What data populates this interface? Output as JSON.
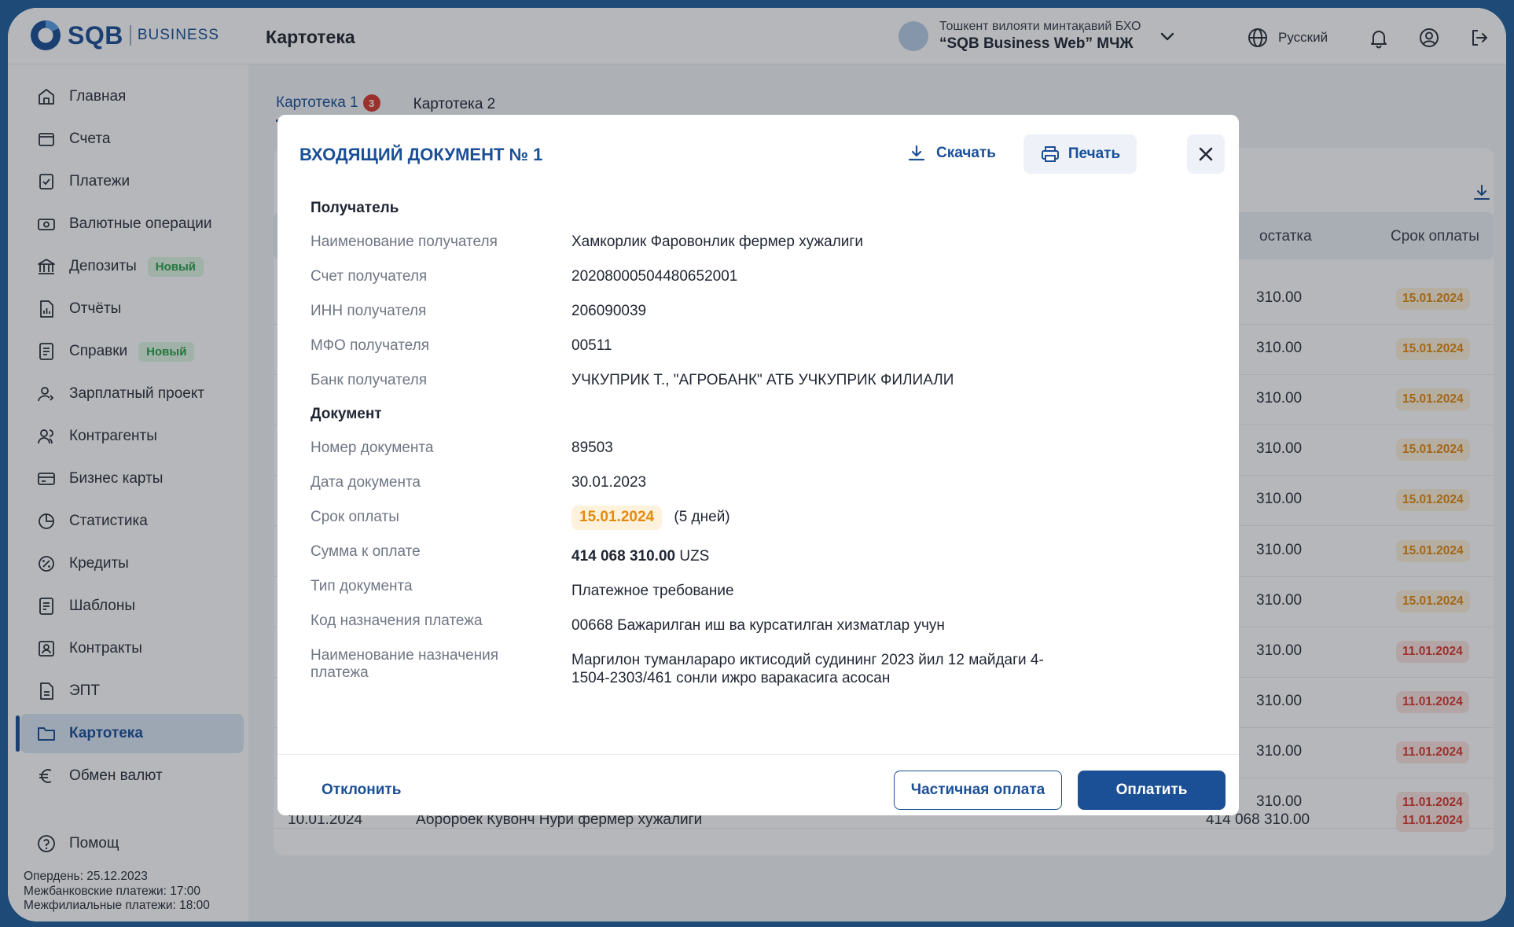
{
  "header": {
    "logo_text": "SQB",
    "logo_sub": "BUSINESS",
    "page_title": "Картотека",
    "company_region": "Тошкент вилояти минтақавий БХО",
    "company_name": "“SQB Business Web” МЧЖ",
    "language": "Русский"
  },
  "sidebar": {
    "items": [
      {
        "label": "Главная",
        "icon": "home-icon"
      },
      {
        "label": "Счета",
        "icon": "wallet-icon"
      },
      {
        "label": "Платежи",
        "icon": "payment-icon"
      },
      {
        "label": "Валютные операции",
        "icon": "currency-icon"
      },
      {
        "label": "Депозиты",
        "icon": "bank-icon",
        "badge": "Новый"
      },
      {
        "label": "Отчёты",
        "icon": "report-icon"
      },
      {
        "label": "Справки",
        "icon": "certificate-icon",
        "badge": "Новый"
      },
      {
        "label": "Зарплатный проект",
        "icon": "salary-icon"
      },
      {
        "label": "Контрагенты",
        "icon": "contacts-icon"
      },
      {
        "label": "Бизнес карты",
        "icon": "card-icon"
      },
      {
        "label": "Статистика",
        "icon": "chart-icon"
      },
      {
        "label": "Кредиты",
        "icon": "loan-icon"
      },
      {
        "label": "Шаблоны",
        "icon": "template-icon"
      },
      {
        "label": "Контракты",
        "icon": "contract-icon"
      },
      {
        "label": "ЭПТ",
        "icon": "document-icon"
      },
      {
        "label": "Картотека",
        "icon": "folder-icon",
        "active": true
      },
      {
        "label": "Обмен валют",
        "icon": "euro-icon"
      },
      {
        "label": "Помощ",
        "icon": "help-icon"
      }
    ],
    "oper_day": "Опердень: 25.12.2023",
    "interbank": "Межбанковские платежи: 17:00",
    "interbranch": "Межфилиальные платежи: 18:00"
  },
  "main": {
    "tabs": [
      {
        "label": "Картотека 1",
        "count": "3",
        "active": true
      },
      {
        "label": "Картотека 2"
      }
    ],
    "columns": [
      "остатка",
      "Срок оплаты"
    ],
    "rows": [
      {
        "amount": "310.00",
        "due": "15.01.2024",
        "status": "orange"
      },
      {
        "amount": "310.00",
        "due": "15.01.2024",
        "status": "orange"
      },
      {
        "amount": "310.00",
        "due": "15.01.2024",
        "status": "orange"
      },
      {
        "amount": "310.00",
        "due": "15.01.2024",
        "status": "orange"
      },
      {
        "amount": "310.00",
        "due": "15.01.2024",
        "status": "orange"
      },
      {
        "amount": "310.00",
        "due": "15.01.2024",
        "status": "orange"
      },
      {
        "amount": "310.00",
        "due": "15.01.2024",
        "status": "orange"
      },
      {
        "amount": "310.00",
        "due": "11.01.2024",
        "status": "red"
      },
      {
        "amount": "310.00",
        "due": "11.01.2024",
        "status": "red"
      },
      {
        "amount": "310.00",
        "due": "11.01.2024",
        "status": "red"
      },
      {
        "amount": "310.00",
        "due": "11.01.2024",
        "status": "red"
      }
    ],
    "last_row": {
      "date": "10.01.2024",
      "name": "Аброрбек Кувонч Нури фермер хужалиги",
      "amount": "414 068 310.00",
      "due": "11.01.2024"
    }
  },
  "modal": {
    "title": "ВХОДЯЩИЙ ДОКУМЕНТ № 1",
    "download": "Скачать",
    "print": "Печать",
    "section_recipient": "Получатель",
    "section_document": "Документ",
    "fields": [
      {
        "label": "Наименование получателя",
        "value": "Хамкорлик Фаровонлик фермер хужалиги"
      },
      {
        "label": "Счет получателя",
        "value": "20208000504480652001"
      },
      {
        "label": "ИНН получателя",
        "value": "206090039"
      },
      {
        "label": "МФО получателя",
        "value": "00511"
      },
      {
        "label": "Банк получателя",
        "value": "УЧКУПРИК Т., \"АГРОБАНК\" АТБ УЧКУПРИК ФИЛИАЛИ"
      },
      {
        "label": "Номер документа",
        "value": "89503"
      },
      {
        "label": "Дата документа",
        "value": "30.01.2023"
      },
      {
        "label": "Срок оплаты",
        "value": "15.01.2024",
        "extra": "(5 дней)"
      },
      {
        "label": "Сумма к оплате",
        "value": "414 068 310.00",
        "currency": "UZS"
      },
      {
        "label": "Тип документа",
        "value": "Платежное требование"
      },
      {
        "label": "Код назначения платежа",
        "value": "00668 Бажарилган иш ва курсатилган хизматлар учун"
      },
      {
        "label": "Наименование назначения платежа",
        "value": "Маргилон туманлараро иктисодий судининг 2023 йил 12 майдаги 4-1504-2303/461 сонли ижро варакасига асосан"
      }
    ],
    "reject": "Отклонить",
    "partial": "Частичная оплата",
    "pay": "Оплатить"
  },
  "colors": {
    "brand": "#1b4f96",
    "due_orange": "#e58a0f",
    "due_red": "#d93a2f",
    "new_badge": "#2aa14a"
  }
}
